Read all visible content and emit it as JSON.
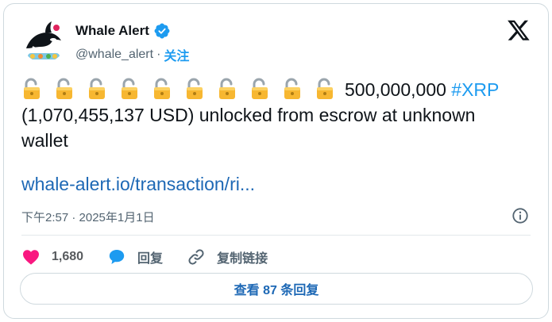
{
  "author": {
    "display_name": "Whale Alert",
    "handle": "@whale_alert",
    "separator": "·",
    "follow_label": "关注"
  },
  "tweet": {
    "lock_emoji_count": 10,
    "amount": "500,000,000",
    "hashtag": "#XRP",
    "body_rest": "(1,070,455,137 USD) unlocked from escrow at unknown wallet",
    "link": "whale-alert.io/transaction/ri...",
    "timestamp": "下午2:57 · 2025年1月1日"
  },
  "actions": {
    "like_count": "1,680",
    "reply_label": "回复",
    "copy_link_label": "复制链接"
  },
  "replies_button_label": "查看 87 条回复",
  "colors": {
    "accent": "#1d9bf0",
    "link": "#1d68b5",
    "like": "#f91880",
    "muted": "#536471"
  }
}
